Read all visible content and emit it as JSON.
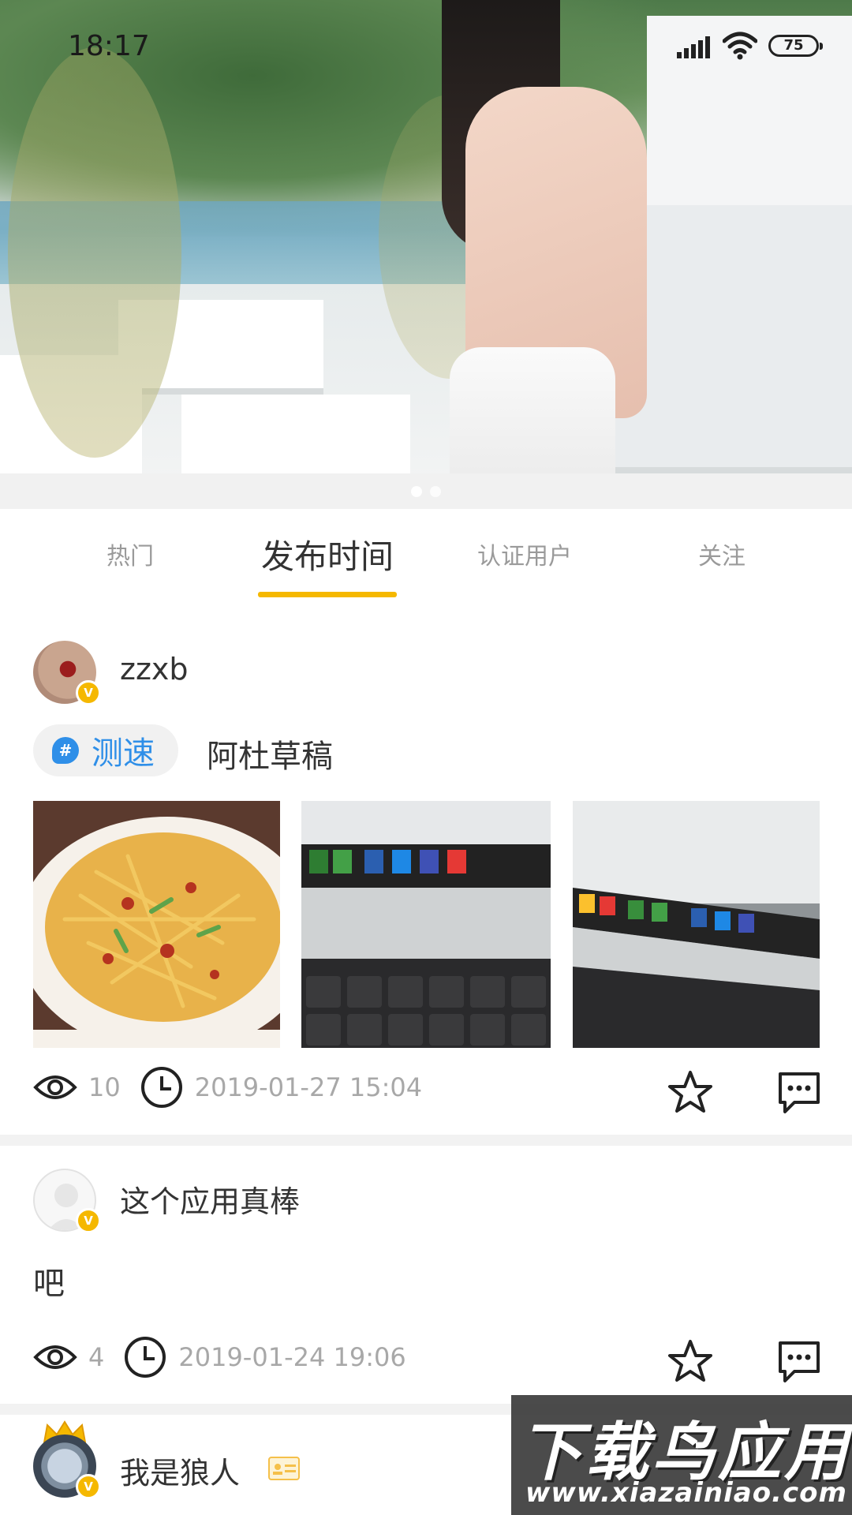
{
  "status_bar": {
    "time": "18:17",
    "battery": "75"
  },
  "tabs": [
    {
      "label": "热门",
      "active": false
    },
    {
      "label": "发布时间",
      "active": true
    },
    {
      "label": "认证用户",
      "active": false
    },
    {
      "label": "关注",
      "active": false
    }
  ],
  "posts": [
    {
      "username": "zzxb",
      "topic": "测速",
      "text": "阿杜草稿",
      "views": "10",
      "timestamp": "2019-01-27 15:04"
    },
    {
      "username": "这个应用真棒",
      "text": "吧",
      "views": "4",
      "timestamp": "2019-01-24 19:06"
    },
    {
      "username": "我是狼人"
    }
  ],
  "watermark": {
    "title": "下载鸟应用",
    "url": "www.xiazainiao.com"
  },
  "colors": {
    "accent": "#f5b800",
    "topic_blue": "#2f8fe8",
    "meta_gray": "#a8a8a8"
  }
}
